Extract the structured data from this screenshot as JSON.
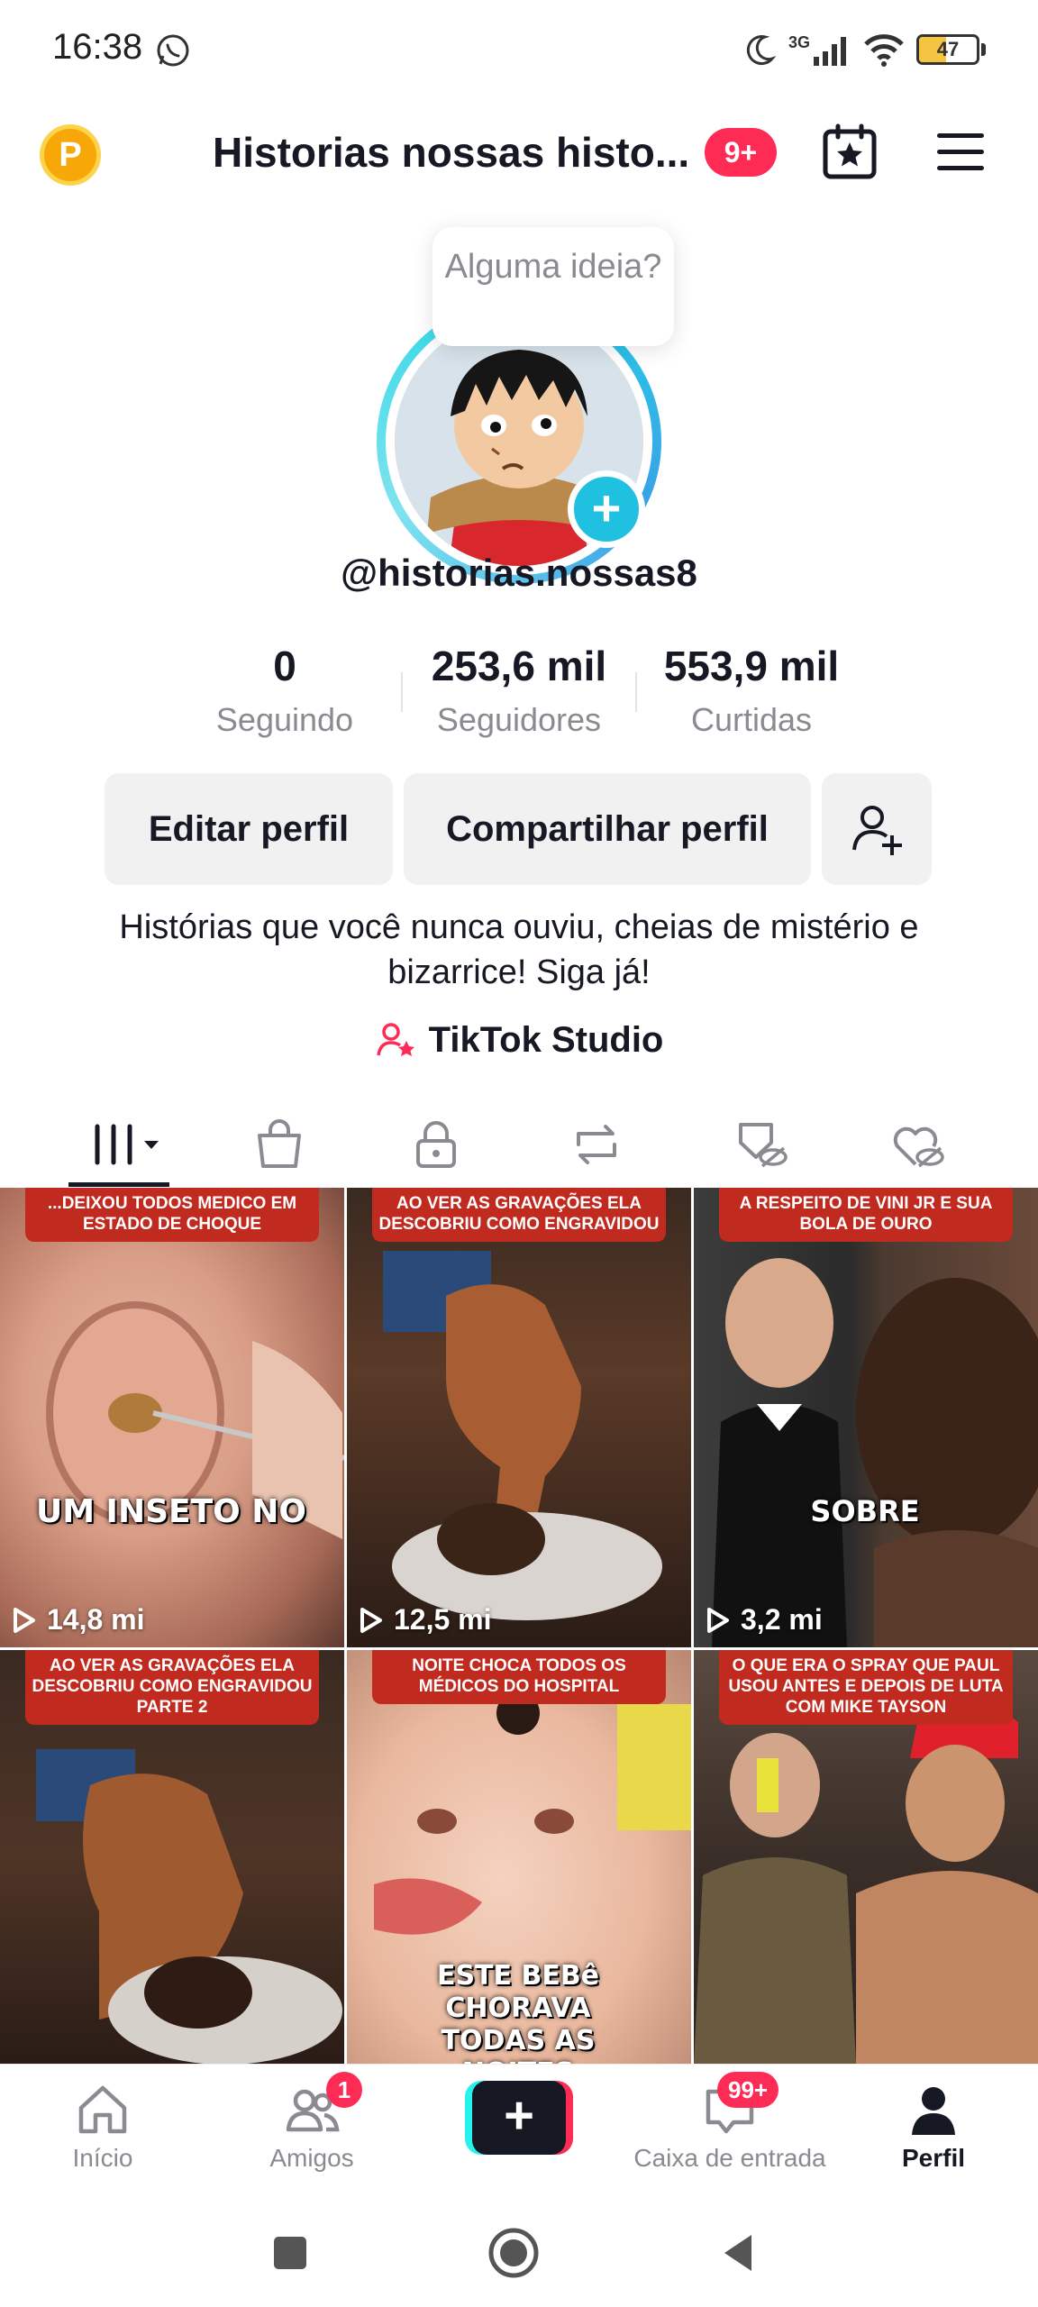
{
  "status_bar": {
    "time": "16:38",
    "network": "3G",
    "battery": "47",
    "battery_level": 0.47
  },
  "header": {
    "points_badge": "P",
    "title": "Historias nossas histo...",
    "notification_badge": "9+"
  },
  "profile": {
    "tooltip": "Alguma ideia?",
    "username": "@historias.nossas8",
    "stats": [
      {
        "value": "0",
        "label": "Seguindo"
      },
      {
        "value": "253,6 mil",
        "label": "Seguidores"
      },
      {
        "value": "553,9 mil",
        "label": "Curtidas"
      }
    ],
    "edit_button": "Editar perfil",
    "share_button": "Compartilhar perfil",
    "bio": "Histórias que você nunca ouviu, cheias de mistério e bizarrice! Siga já!",
    "studio_link": "TikTok Studio"
  },
  "videos": [
    {
      "caption": "...deixou todos medico em estado de choque",
      "overlay": "UM INSETO NO",
      "views": "14,8 mi"
    },
    {
      "caption": "Ao ver as gravações ela descobriu como engravidou",
      "overlay": "",
      "views": "12,5 mi"
    },
    {
      "caption": "A respeito de Vini Jr e sua bola de ouro",
      "overlay": "SOBRE",
      "views": "3,2 mi"
    },
    {
      "caption": "Ao ver as gravações ela descobriu como engravidou parte 2",
      "overlay": "",
      "views": ""
    },
    {
      "caption": "noite choca todos os médicos do hospital",
      "overlay": "ESTE BEBê CHORAVA TODAS AS NOITES",
      "views": ""
    },
    {
      "caption": "O que era o spray que Paul usou antes e depois de luta com Mike Tayson",
      "overlay": "",
      "views": ""
    }
  ],
  "bottom_nav": {
    "home": "Início",
    "friends": "Amigos",
    "friends_badge": "1",
    "inbox": "Caixa de entrada",
    "inbox_badge": "99+",
    "profile": "Perfil"
  },
  "colors": {
    "accent": "#fe2c55",
    "cyan": "#25f4ee",
    "caption_red": "#c12a1f"
  }
}
